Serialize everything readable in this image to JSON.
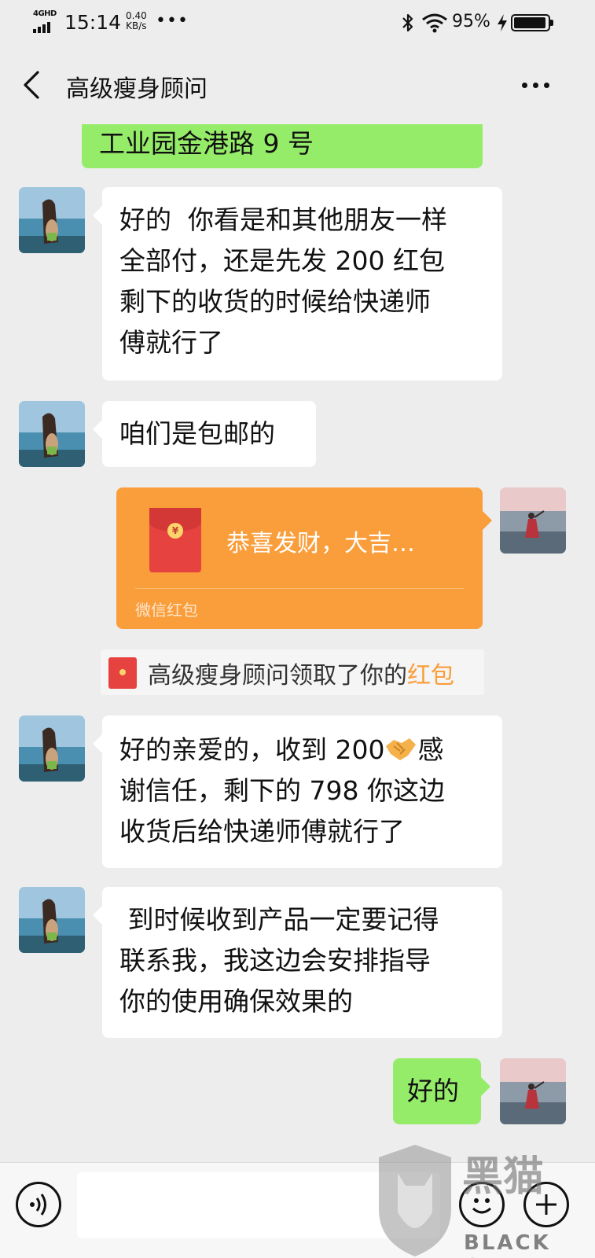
{
  "status_bar": {
    "network": "4GHD",
    "time": "15:14",
    "speed_value": "0.40",
    "speed_unit": "KB/s",
    "more": "•••",
    "battery_pct": "95%",
    "battery_level": 0.95
  },
  "nav": {
    "title": "高级瘦身顾问",
    "back_icon": "chevron-left-icon",
    "more_icon": "more-dots-icon"
  },
  "messages": [
    {
      "side": "out",
      "text": "工业园金港路 9 号"
    },
    {
      "side": "in",
      "lines": [
        "好的  你看是和其他朋友一样",
        "全部付，还是先发 200 红包",
        "剩下的收货的时候给快递师",
        "傅就行了"
      ]
    },
    {
      "side": "in",
      "text": "咱们是包邮的"
    },
    {
      "side": "in",
      "line1_before": "好的亲爱的，收到 200",
      "line1_after": "感",
      "lines": [
        "谢信任，剩下的 798 你这边",
        "收货后给快递师傅就行了"
      ]
    },
    {
      "side": "in",
      "lines": [
        " 到时候收到产品一定要记得",
        "联系我，我这边会安排指导",
        "你的使用确保效果的"
      ]
    },
    {
      "side": "out",
      "text": "好的"
    }
  ],
  "red_packet": {
    "text": "恭喜发财，大吉…",
    "label": "微信红包",
    "coin": "¥"
  },
  "notice": {
    "text": "高级瘦身顾问领取了你的",
    "link": "红包"
  },
  "watermark": {
    "brand": "BLACK CAT",
    "chars": "黑猫"
  },
  "colors": {
    "background": "#ededed",
    "outgoing_bubble": "#95ec69",
    "incoming_bubble": "#ffffff",
    "red_packet": "#fa9d3b",
    "red_packet_link": "#fa9d3b"
  }
}
